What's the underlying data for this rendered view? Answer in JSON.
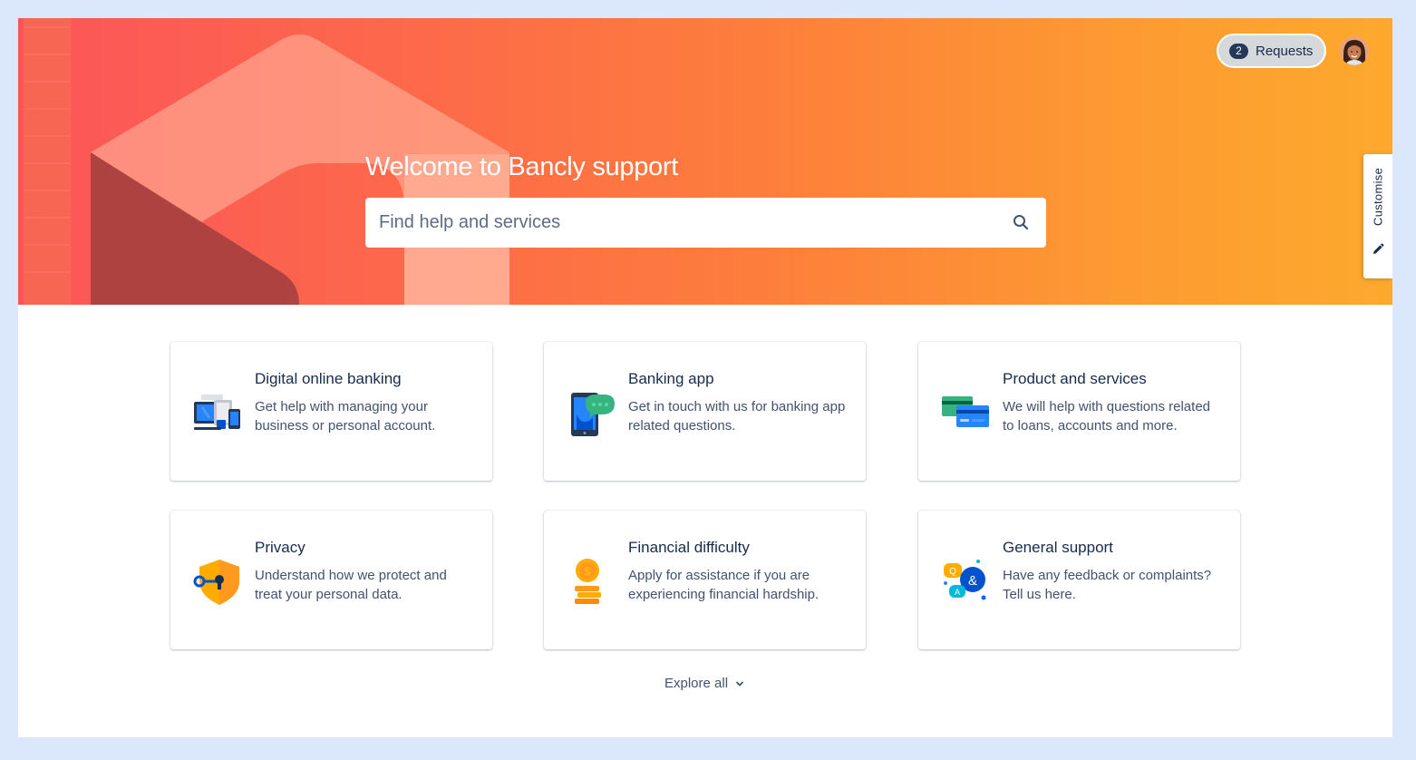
{
  "header": {
    "requests_count": "2",
    "requests_label": "Requests",
    "customise_label": "Customise"
  },
  "hero": {
    "title": "Welcome to Bancly support",
    "search_placeholder": "Find help and services"
  },
  "cards": [
    {
      "title": "Digital online banking",
      "desc": "Get help with managing your business or personal account.",
      "icon": "devices-icon"
    },
    {
      "title": "Banking app",
      "desc": "Get in touch with us for banking app related questions.",
      "icon": "phone-chat-icon"
    },
    {
      "title": "Product and services",
      "desc": "We will help with questions related to loans, accounts and more.",
      "icon": "credit-cards-icon"
    },
    {
      "title": "Privacy",
      "desc": "Understand how we protect and treat your personal data.",
      "icon": "shield-key-icon"
    },
    {
      "title": "Financial difficulty",
      "desc": "Apply for assistance if you are experiencing financial hardship.",
      "icon": "coins-icon"
    },
    {
      "title": "General support",
      "desc": "Have any feedback or complaints? Tell us here.",
      "icon": "speech-bubbles-icon"
    }
  ],
  "footer": {
    "explore_label": "Explore all"
  },
  "colors": {
    "hero_start": "#fb5559",
    "hero_end": "#fda92d",
    "text_primary": "#172b4d",
    "text_secondary": "#42526e"
  }
}
